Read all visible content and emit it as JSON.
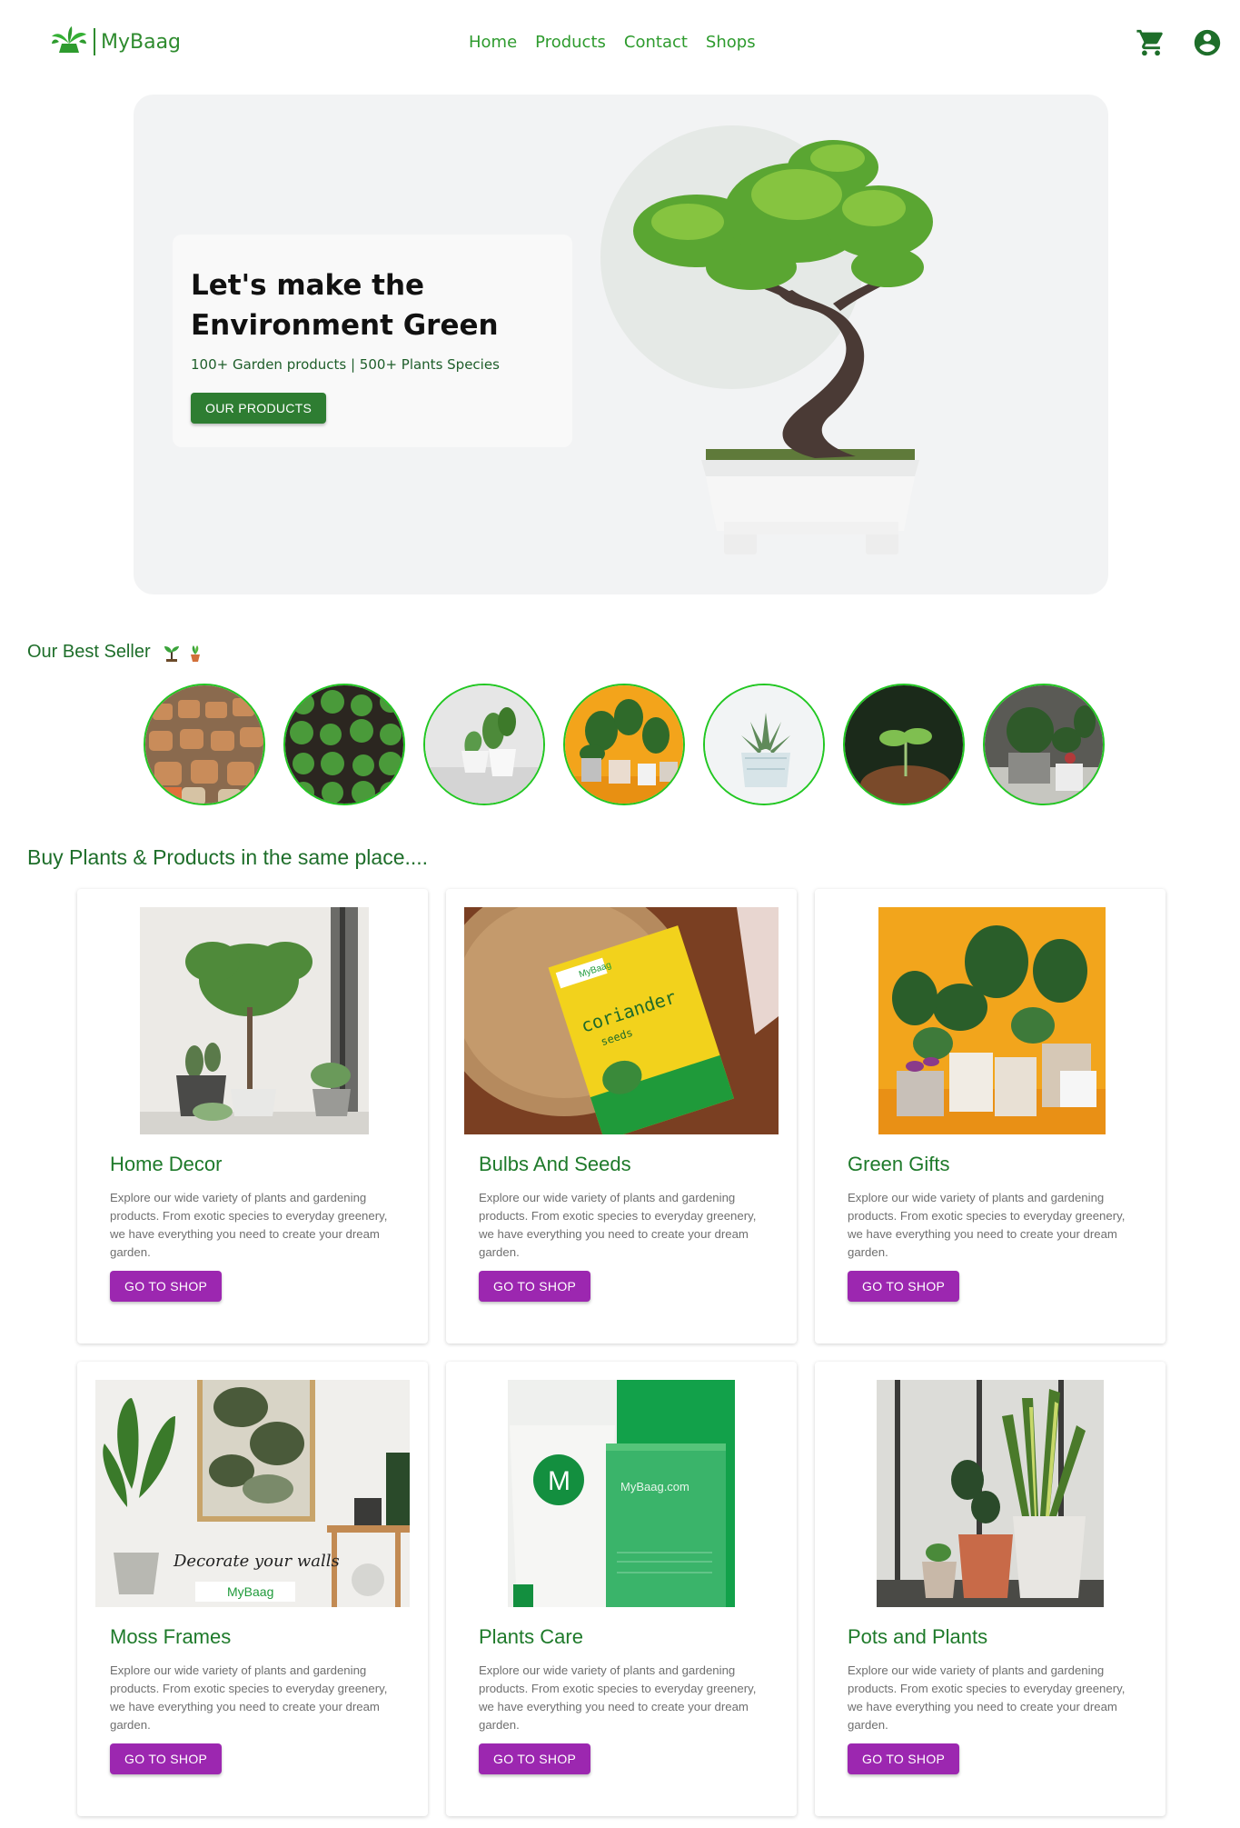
{
  "nav": {
    "brand": "MyBaag",
    "links": [
      "Home",
      "Products",
      "Contact",
      "Shops"
    ],
    "colors": {
      "primary": "#2e9b2e",
      "dark": "#1e6e2a"
    }
  },
  "hero": {
    "title_line1": "Let's make the",
    "title_line2": "Environment Green",
    "subtitle": "100+ Garden products | 500+ Plants Species",
    "button": "OUR PRODUCTS"
  },
  "best_seller": {
    "title": "Our Best Seller",
    "icons": [
      "seedling-icon",
      "potted-plant-icon"
    ],
    "items": [
      {
        "name": "terracotta-pots"
      },
      {
        "name": "seedling-trays"
      },
      {
        "name": "white-vase-plant"
      },
      {
        "name": "yellow-wall-plants"
      },
      {
        "name": "succulent-pot"
      },
      {
        "name": "sprout-soil"
      },
      {
        "name": "grey-pot-plants"
      }
    ]
  },
  "buy_section": {
    "title": "Buy Plants & Products in the same place...."
  },
  "products": [
    {
      "title": "Home Decor",
      "description": "Explore our wide variety of plants and gardening products. From exotic species to everyday greenery, we have everything you need to create your dream garden.",
      "button": "GO TO SHOP"
    },
    {
      "title": "Bulbs And Seeds",
      "description": "Explore our wide variety of plants and gardening products. From exotic species to everyday greenery, we have everything you need to create your dream garden.",
      "button": "GO TO SHOP",
      "image_text": {
        "brand": "MyBaag",
        "product": "coriander",
        "type": "seeds"
      }
    },
    {
      "title": "Green Gifts",
      "description": "Explore our wide variety of plants and gardening products. From exotic species to everyday greenery, we have everything you need to create your dream garden.",
      "button": "GO TO SHOP"
    },
    {
      "title": "Moss Frames",
      "description": "Explore our wide variety of plants and gardening products. From exotic species to everyday greenery, we have everything you need to create your dream garden.",
      "button": "GO TO SHOP",
      "image_text": {
        "caption": "Decorate your walls",
        "brand": "MyBaag"
      }
    },
    {
      "title": "Plants Care",
      "description": "Explore our wide variety of plants and gardening products. From exotic species to everyday greenery, we have everything you need to create your dream garden.",
      "button": "GO TO SHOP",
      "image_text": {
        "letter": "M",
        "brand": "MyBaag.com"
      }
    },
    {
      "title": "Pots and Plants",
      "description": "Explore our wide variety of plants and gardening products. From exotic species to everyday greenery, we have everything you need to create your dream garden.",
      "button": "GO TO SHOP"
    }
  ]
}
